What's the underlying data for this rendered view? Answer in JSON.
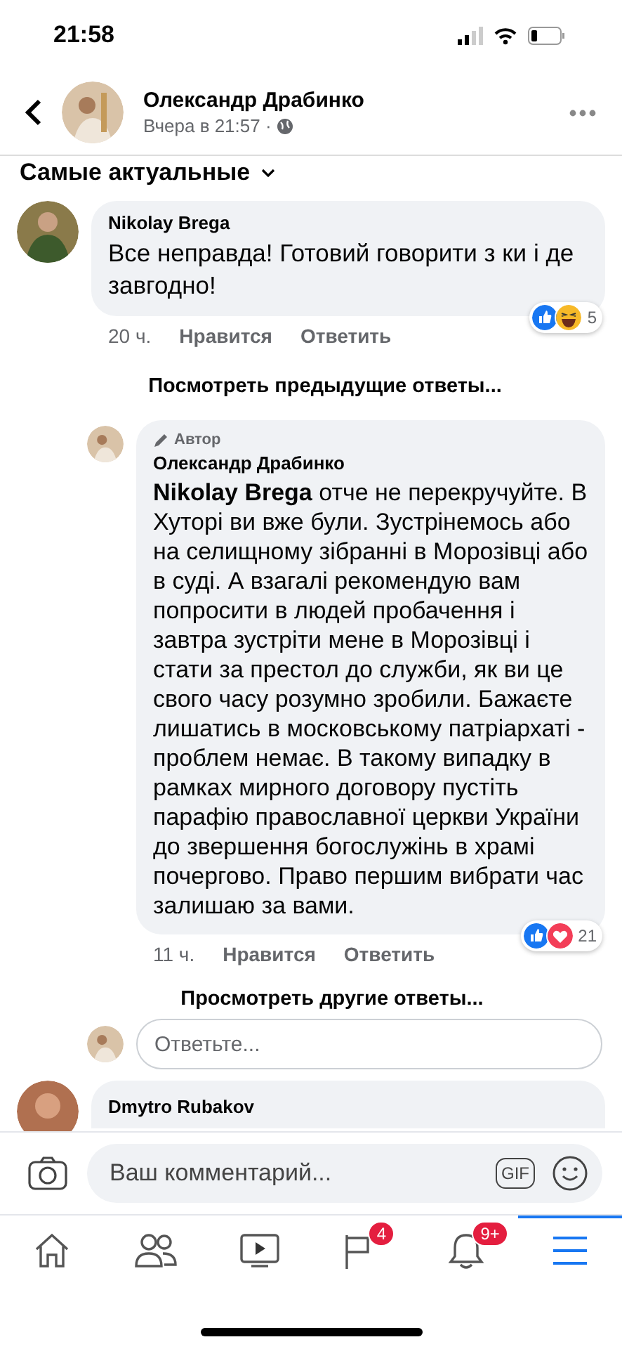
{
  "status_bar": {
    "time": "21:58"
  },
  "header": {
    "author": "Олександр Драбинко",
    "time": "Вчера в 21:57 ·"
  },
  "sort": {
    "label": "Самые актуальные"
  },
  "comment": {
    "author": "Nikolay Brega",
    "text": "Все неправда! Готовий говорити з ки і де завгодно!",
    "time": "20 ч.",
    "like": "Нравится",
    "reply": "Ответить",
    "reactions": [
      {
        "kind": "like"
      },
      {
        "kind": "haha"
      }
    ],
    "reaction_count": "5"
  },
  "previous_replies": "Посмотреть предыдущие ответы...",
  "reply": {
    "badge": "Автор",
    "author": "Олександр Драбинко",
    "text": "**Nikolay Brega** отче не перекручуйте. В Хуторі ви вже були. Зустрінемось або на селищному зібранні в Морозівці або в суді. А взагалі рекомендую вам попросити в людей пробачення і завтра зустріти мене в Морозівці і стати за престол до служби, як ви це свого часу розумно зробили. Бажаєте лишатись в московському патріархаті - проблем немає. В такому випадку в рамках мирного договору пустіть парафію православної церкви України до звершення богослужінь в храмі почергово. Право першим вибрати час залишаю за вами.",
    "time": "11 ч.",
    "like": "Нравится",
    "reply": "Ответить",
    "reactions": [
      {
        "kind": "like"
      },
      {
        "kind": "love"
      }
    ],
    "reaction_count": "21"
  },
  "other_replies": "Просмотреть другие ответы...",
  "reply_field": {
    "placeholder": "Ответьте..."
  },
  "next_comment": {
    "author": "Dmytro Rubakov"
  },
  "composer": {
    "placeholder": "Ваш комментарий...",
    "gif": "GIF"
  },
  "tabs": [
    {
      "kind": "home",
      "selected": false
    },
    {
      "kind": "friends",
      "selected": false
    },
    {
      "kind": "video",
      "selected": false
    },
    {
      "kind": "pages",
      "selected": false,
      "badge": "4"
    },
    {
      "kind": "notifications",
      "selected": false,
      "badge": "9+"
    },
    {
      "kind": "menu",
      "selected": true
    }
  ]
}
